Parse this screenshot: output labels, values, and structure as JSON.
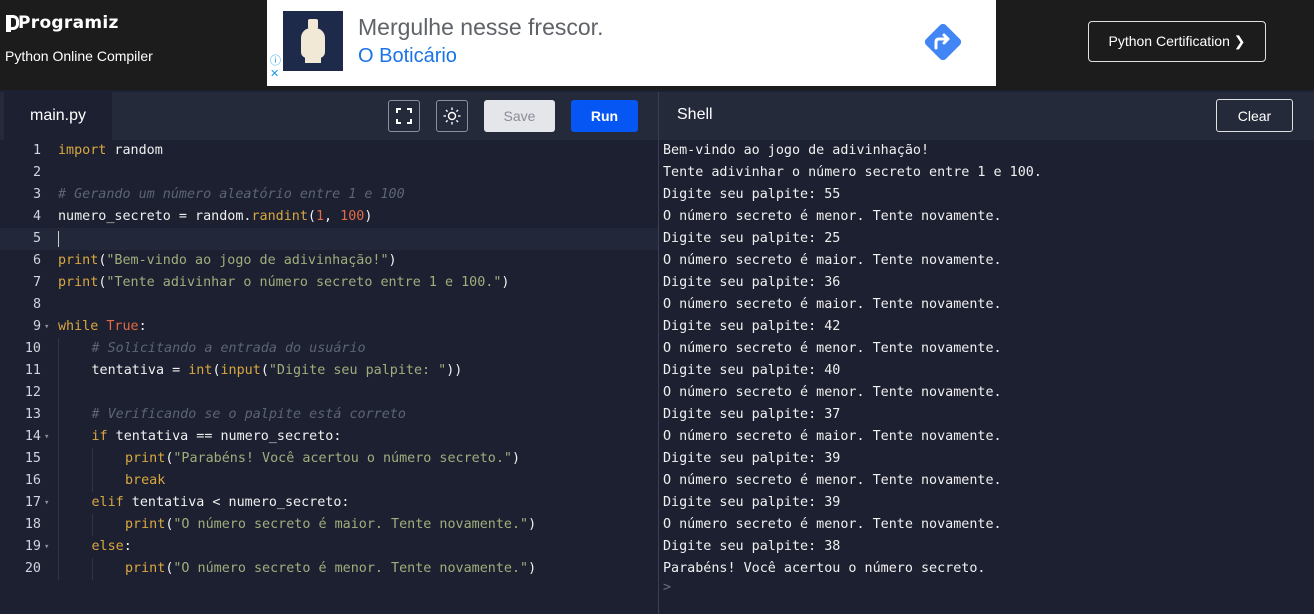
{
  "header": {
    "logo_text": "Programiz",
    "subtitle": "Python Online Compiler",
    "cert_button": "Python Certification ❯"
  },
  "ad": {
    "title": "Mergulhe nesse frescor.",
    "brand": "O Boticário",
    "info_icon": "ⓘ",
    "close_icon": "✕"
  },
  "editor": {
    "tab": "main.py",
    "save_label": "Save",
    "run_label": "Run",
    "lines": [
      {
        "n": "1",
        "fold": "",
        "indent": 0,
        "tokens": [
          [
            "kw",
            "import"
          ],
          [
            "plain",
            " random"
          ]
        ]
      },
      {
        "n": "2",
        "fold": "",
        "indent": 0,
        "tokens": []
      },
      {
        "n": "3",
        "fold": "",
        "indent": 0,
        "tokens": [
          [
            "cm",
            "# Gerando um número aleatório entre 1 e 100"
          ]
        ]
      },
      {
        "n": "4",
        "fold": "",
        "indent": 0,
        "tokens": [
          [
            "plain",
            "numero_secreto = random."
          ],
          [
            "fn",
            "randint"
          ],
          [
            "plain",
            "("
          ],
          [
            "num",
            "1"
          ],
          [
            "plain",
            ", "
          ],
          [
            "num",
            "100"
          ],
          [
            "plain",
            ")"
          ]
        ]
      },
      {
        "n": "5",
        "fold": "",
        "indent": 0,
        "tokens": [],
        "active": true
      },
      {
        "n": "6",
        "fold": "",
        "indent": 0,
        "tokens": [
          [
            "fn",
            "print"
          ],
          [
            "plain",
            "("
          ],
          [
            "str",
            "\"Bem-vindo ao jogo de adivinhação!\""
          ],
          [
            "plain",
            ")"
          ]
        ]
      },
      {
        "n": "7",
        "fold": "",
        "indent": 0,
        "tokens": [
          [
            "fn",
            "print"
          ],
          [
            "plain",
            "("
          ],
          [
            "str",
            "\"Tente adivinhar o número secreto entre 1 e 100.\""
          ],
          [
            "plain",
            ")"
          ]
        ]
      },
      {
        "n": "8",
        "fold": "",
        "indent": 0,
        "tokens": []
      },
      {
        "n": "9",
        "fold": "▾",
        "indent": 0,
        "tokens": [
          [
            "kw",
            "while"
          ],
          [
            "plain",
            " "
          ],
          [
            "num",
            "True"
          ],
          [
            "plain",
            ":"
          ]
        ]
      },
      {
        "n": "10",
        "fold": "",
        "indent": 1,
        "tokens": [
          [
            "cm",
            "# Solicitando a entrada do usuário"
          ]
        ]
      },
      {
        "n": "11",
        "fold": "",
        "indent": 1,
        "tokens": [
          [
            "plain",
            "tentativa = "
          ],
          [
            "fn",
            "int"
          ],
          [
            "plain",
            "("
          ],
          [
            "fn",
            "input"
          ],
          [
            "plain",
            "("
          ],
          [
            "str",
            "\"Digite seu palpite: \""
          ],
          [
            "plain",
            "))"
          ]
        ]
      },
      {
        "n": "12",
        "fold": "",
        "indent": 1,
        "tokens": []
      },
      {
        "n": "13",
        "fold": "",
        "indent": 1,
        "tokens": [
          [
            "cm",
            "# Verificando se o palpite está correto"
          ]
        ]
      },
      {
        "n": "14",
        "fold": "▾",
        "indent": 1,
        "tokens": [
          [
            "kw",
            "if"
          ],
          [
            "plain",
            " tentativa == numero_secreto:"
          ]
        ]
      },
      {
        "n": "15",
        "fold": "",
        "indent": 2,
        "tokens": [
          [
            "fn",
            "print"
          ],
          [
            "plain",
            "("
          ],
          [
            "str",
            "\"Parabéns! Você acertou o número secreto.\""
          ],
          [
            "plain",
            ")"
          ]
        ]
      },
      {
        "n": "16",
        "fold": "",
        "indent": 2,
        "tokens": [
          [
            "kw",
            "break"
          ]
        ]
      },
      {
        "n": "17",
        "fold": "▾",
        "indent": 1,
        "tokens": [
          [
            "kw",
            "elif"
          ],
          [
            "plain",
            " tentativa < numero_secreto:"
          ]
        ]
      },
      {
        "n": "18",
        "fold": "",
        "indent": 2,
        "tokens": [
          [
            "fn",
            "print"
          ],
          [
            "plain",
            "("
          ],
          [
            "str",
            "\"O número secreto é maior. Tente novamente.\""
          ],
          [
            "plain",
            ")"
          ]
        ]
      },
      {
        "n": "19",
        "fold": "▾",
        "indent": 1,
        "tokens": [
          [
            "kw",
            "else"
          ],
          [
            "plain",
            ":"
          ]
        ]
      },
      {
        "n": "20",
        "fold": "",
        "indent": 2,
        "tokens": [
          [
            "fn",
            "print"
          ],
          [
            "plain",
            "("
          ],
          [
            "str",
            "\"O número secreto é menor. Tente novamente.\""
          ],
          [
            "plain",
            ")"
          ]
        ]
      }
    ]
  },
  "shell": {
    "title": "Shell",
    "clear_label": "Clear",
    "prompt": ">",
    "output": [
      "Bem-vindo ao jogo de adivinhação!",
      "Tente adivinhar o número secreto entre 1 e 100.",
      "Digite seu palpite: 55",
      "O número secreto é menor. Tente novamente.",
      "Digite seu palpite: 25",
      "O número secreto é maior. Tente novamente.",
      "Digite seu palpite: 36",
      "O número secreto é maior. Tente novamente.",
      "Digite seu palpite: 42",
      "O número secreto é menor. Tente novamente.",
      "Digite seu palpite: 40",
      "O número secreto é menor. Tente novamente.",
      "Digite seu palpite: 37",
      "O número secreto é maior. Tente novamente.",
      "Digite seu palpite: 39",
      "O número secreto é menor. Tente novamente.",
      "Digite seu palpite: 39",
      "O número secreto é menor. Tente novamente.",
      "Digite seu palpite: 38",
      "Parabéns! Você acertou o número secreto."
    ]
  },
  "colors": {
    "run_button": "#0556f3",
    "background": "#1c2030",
    "keyword": "#d9a740",
    "string": "#9fae7c",
    "number": "#e36a46",
    "comment": "#5c6475"
  },
  "icons": {
    "fullscreen": "fullscreen-icon",
    "theme": "sun-icon",
    "ad_arrow": "directions-arrow-icon"
  }
}
